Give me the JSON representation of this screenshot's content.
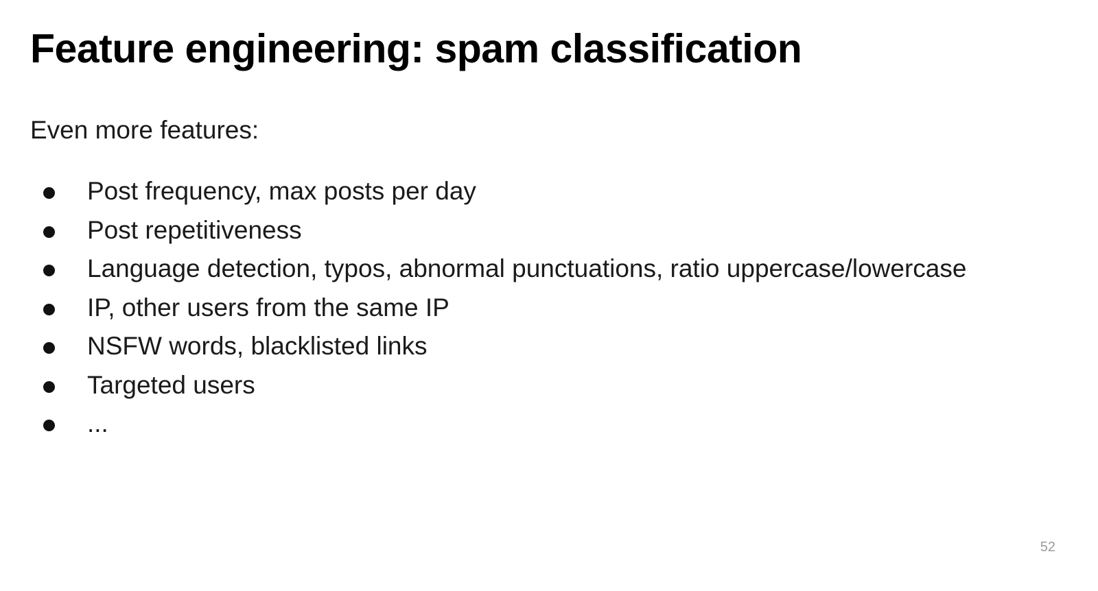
{
  "slide": {
    "title": "Feature engineering: spam classification",
    "intro": "Even more features:",
    "bullets": [
      "Post frequency, max posts per day",
      "Post repetitiveness",
      "Language detection, typos, abnormal punctuations, ratio uppercase/lowercase",
      "IP, other users from the same IP",
      "NSFW words, blacklisted links",
      "Targeted users",
      "..."
    ],
    "page_number": "52"
  }
}
